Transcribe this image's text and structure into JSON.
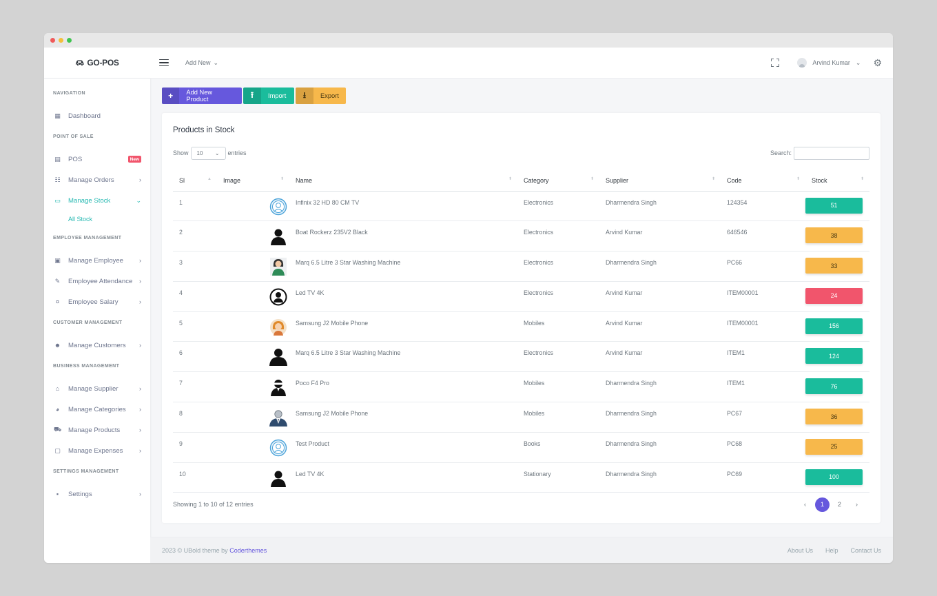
{
  "topbar": {
    "logo_text": "GO-POS",
    "add_new_label": "Add New",
    "user_name": "Arvind Kumar"
  },
  "sidebar": {
    "sections": {
      "navigation": "NAVIGATION",
      "pos": "POINT OF SALE",
      "employee": "EMPLOYEE MANAGEMENT",
      "customer": "CUSTOMER MANAGEMENT",
      "business": "BUSINESS MANAGEMENT",
      "settings": "SETTINGS MANAGEMENT"
    },
    "items": {
      "dashboard": "Dashboard",
      "pos": "POS",
      "pos_badge": "New",
      "orders": "Manage Orders",
      "stock": "Manage Stock",
      "all_stock": "All Stock",
      "employee": "Manage Employee",
      "attendance": "Employee Attendance",
      "salary": "Employee Salary",
      "customers": "Manage Customers",
      "supplier": "Manage Supplier",
      "categories": "Manage Categories",
      "products": "Manage Products",
      "expenses": "Manage Expenses",
      "settings": "Settings"
    }
  },
  "actions": {
    "add": "Add New Product",
    "import": "Import",
    "export": "Export"
  },
  "card": {
    "title": "Products in Stock",
    "show_label": "Show",
    "entries_label": "entries",
    "page_size": "10",
    "search_label": "Search:",
    "search_value": ""
  },
  "table": {
    "headers": {
      "sl": "Sl",
      "image": "Image",
      "name": "Name",
      "category": "Category",
      "supplier": "Supplier",
      "code": "Code",
      "stock": "Stock"
    },
    "rows": [
      {
        "sl": "1",
        "avatar": "blue-circle-face",
        "name": "Infinix 32 HD 80 CM TV",
        "category": "Electronics",
        "supplier": "Dharmendra Singh",
        "code": "124354",
        "stock": "51",
        "stock_color": "green"
      },
      {
        "sl": "2",
        "avatar": "black-silhouette",
        "name": "Boat Rockerz 235V2 Black",
        "category": "Electronics",
        "supplier": "Arvind Kumar",
        "code": "646546",
        "stock": "38",
        "stock_color": "yellow"
      },
      {
        "sl": "3",
        "avatar": "woman-green",
        "name": "Marq 6.5 Litre 3 Star Washing Machine",
        "category": "Electronics",
        "supplier": "Dharmendra Singh",
        "code": "PC66",
        "stock": "33",
        "stock_color": "yellow"
      },
      {
        "sl": "4",
        "avatar": "circle-user",
        "name": "Led TV 4K",
        "category": "Electronics",
        "supplier": "Arvind Kumar",
        "code": "ITEM00001",
        "stock": "24",
        "stock_color": "red"
      },
      {
        "sl": "5",
        "avatar": "woman-orange",
        "name": "Samsung J2 Mobile Phone",
        "category": "Mobiles",
        "supplier": "Arvind Kumar",
        "code": "ITEM00001",
        "stock": "156",
        "stock_color": "green"
      },
      {
        "sl": "6",
        "avatar": "black-silhouette-large",
        "name": "Marq 6.5 Litre 3 Star Washing Machine",
        "category": "Electronics",
        "supplier": "Arvind Kumar",
        "code": "ITEM1",
        "stock": "124",
        "stock_color": "green"
      },
      {
        "sl": "7",
        "avatar": "user-mask",
        "name": "Poco F4 Pro",
        "category": "Mobiles",
        "supplier": "Dharmendra Singh",
        "code": "ITEM1",
        "stock": "76",
        "stock_color": "green"
      },
      {
        "sl": "8",
        "avatar": "man-suit",
        "name": "Samsung J2 Mobile Phone",
        "category": "Mobiles",
        "supplier": "Dharmendra Singh",
        "code": "PC67",
        "stock": "36",
        "stock_color": "yellow"
      },
      {
        "sl": "9",
        "avatar": "blue-circle-face",
        "name": "Test Product",
        "category": "Books",
        "supplier": "Dharmendra Singh",
        "code": "PC68",
        "stock": "25",
        "stock_color": "yellow"
      },
      {
        "sl": "10",
        "avatar": "black-silhouette",
        "name": "Led TV 4K",
        "category": "Stationary",
        "supplier": "Dharmendra Singh",
        "code": "PC69",
        "stock": "100",
        "stock_color": "green"
      }
    ]
  },
  "pagination": {
    "info": "Showing 1 to 10 of 12 entries",
    "pages": [
      "1",
      "2"
    ],
    "current": "1"
  },
  "footer": {
    "copyright": "2023 © UBold theme by",
    "brand": "Coderthemes",
    "links": [
      "About Us",
      "Help",
      "Contact Us"
    ]
  },
  "colors": {
    "primary": "#6658dd",
    "success": "#1abc9c",
    "warning": "#f7b84b",
    "danger": "#f1556c",
    "active_nav": "#26b9b2"
  }
}
